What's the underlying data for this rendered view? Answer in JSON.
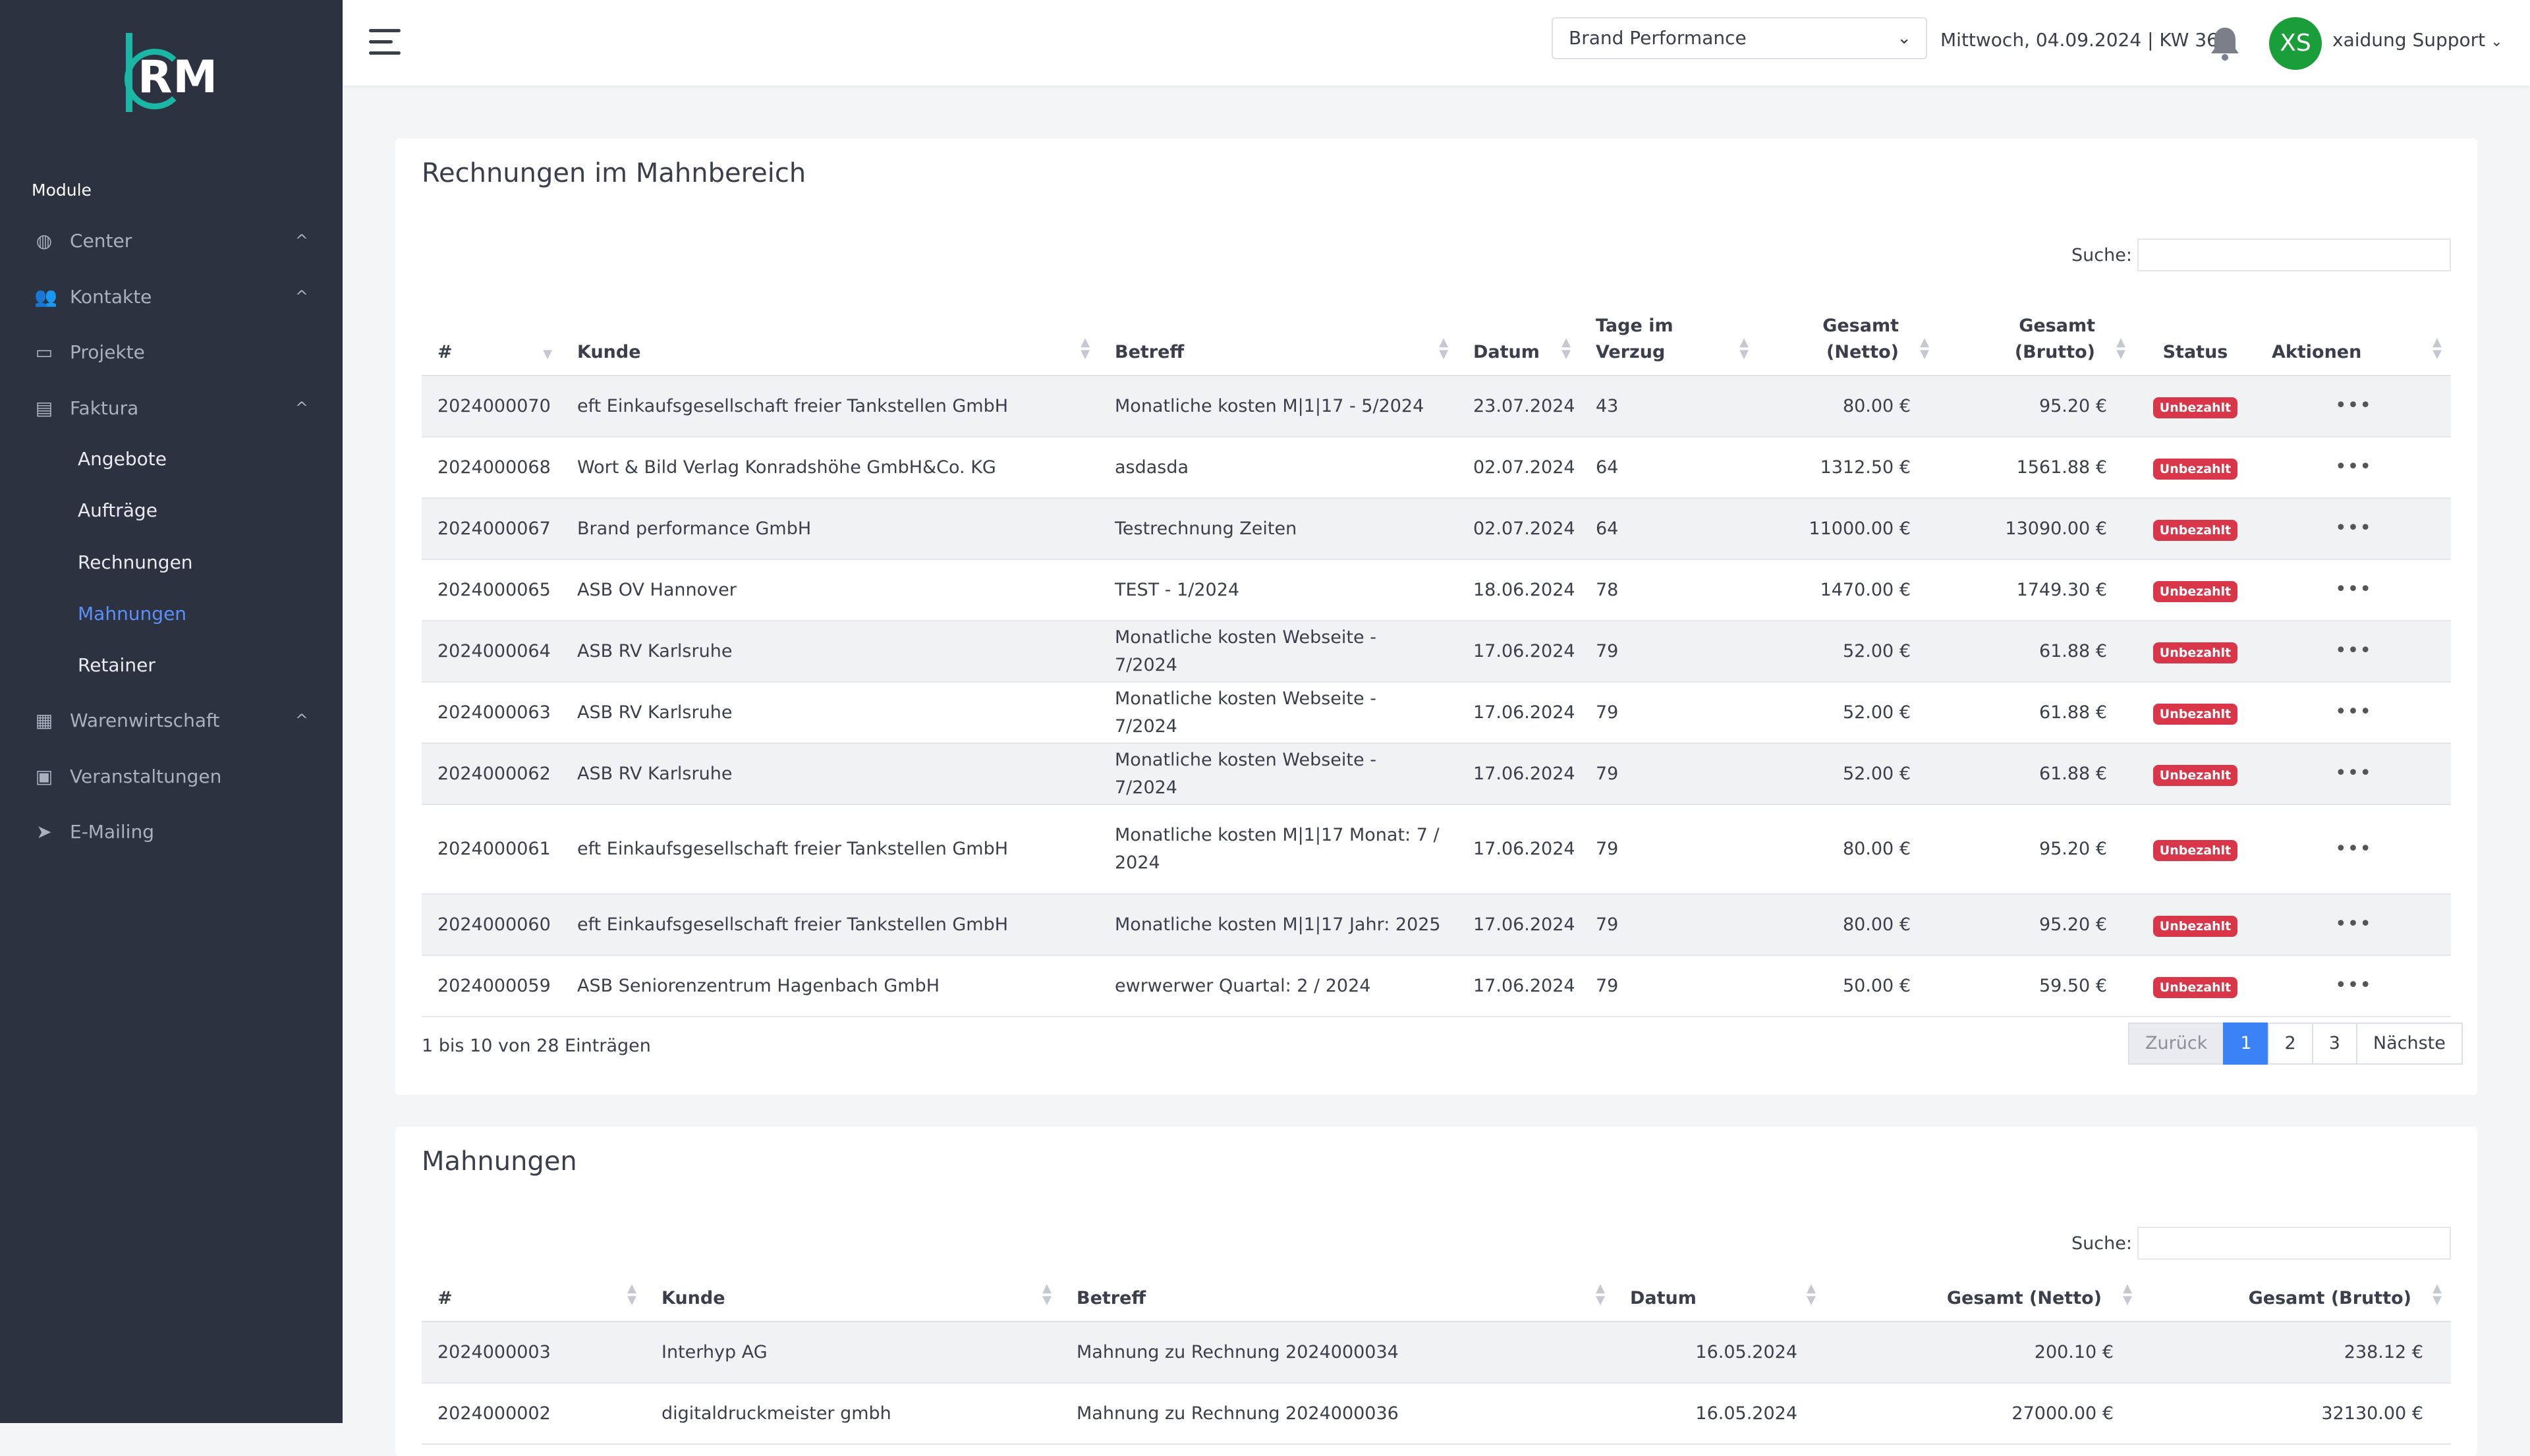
{
  "logo": "RM",
  "sidebar": {
    "module_label": "Module",
    "items": [
      {
        "label": "Center",
        "icon": "globe-icon",
        "glyph": "◍",
        "chevron": "^"
      },
      {
        "label": "Kontakte",
        "icon": "users-icon",
        "glyph": "👥",
        "chevron": "^"
      },
      {
        "label": "Projekte",
        "icon": "monitor-icon",
        "glyph": "▭",
        "chevron": ""
      },
      {
        "label": "Faktura",
        "icon": "money-icon",
        "glyph": "▤",
        "chevron": "^"
      },
      {
        "label": "Warenwirtschaft",
        "icon": "cubes-icon",
        "glyph": "▦",
        "chevron": "^"
      },
      {
        "label": "Veranstaltungen",
        "icon": "calendar-icon",
        "glyph": "▣",
        "chevron": ""
      },
      {
        "label": "E-Mailing",
        "icon": "paper-plane-icon",
        "glyph": "➤",
        "chevron": ""
      }
    ],
    "sub_items": [
      "Angebote",
      "Aufträge",
      "Rechnungen",
      "Mahnungen",
      "Retainer"
    ],
    "active_sub": "Mahnungen"
  },
  "topbar": {
    "company_select": "Brand Performance",
    "date": "Mittwoch, 04.09.2024 | KW 36",
    "avatar_initials": "XS",
    "avatar_color": "#1a9e3a",
    "username": "xaidung Support"
  },
  "invoices": {
    "title": "Rechnungen im Mahnbereich",
    "search_label": "Suche:",
    "columns": {
      "num": "#",
      "kunde": "Kunde",
      "betreff": "Betreff",
      "datum": "Datum",
      "tage_1": "Tage im",
      "tage_2": "Verzug",
      "netto_1": "Gesamt",
      "netto_2": "(Netto)",
      "brutto_1": "Gesamt",
      "brutto_2": "(Brutto)",
      "status": "Status",
      "aktionen": "Aktionen"
    },
    "rows": [
      {
        "num": "2024000070",
        "kunde": "eft Einkaufsgesellschaft freier Tankstellen GmbH",
        "betreff": "Monatliche kosten M|1|17 - 5/2024",
        "datum": "23.07.2024",
        "tage": "43",
        "netto": "80.00 €",
        "brutto": "95.20 €",
        "status": "Unbezahlt"
      },
      {
        "num": "2024000068",
        "kunde": "Wort & Bild Verlag Konradshöhe GmbH&Co. KG",
        "betreff": "asdasda",
        "datum": "02.07.2024",
        "tage": "64",
        "netto": "1312.50 €",
        "brutto": "1561.88 €",
        "status": "Unbezahlt"
      },
      {
        "num": "2024000067",
        "kunde": "Brand performance GmbH",
        "betreff": "Testrechnung Zeiten",
        "datum": "02.07.2024",
        "tage": "64",
        "netto": "11000.00 €",
        "brutto": "13090.00 €",
        "status": "Unbezahlt"
      },
      {
        "num": "2024000065",
        "kunde": "ASB OV Hannover",
        "betreff": "TEST - 1/2024",
        "datum": "18.06.2024",
        "tage": "78",
        "netto": "1470.00 €",
        "brutto": "1749.30 €",
        "status": "Unbezahlt"
      },
      {
        "num": "2024000064",
        "kunde": "ASB RV Karlsruhe",
        "betreff": "Monatliche kosten Webseite - 7/2024",
        "datum": "17.06.2024",
        "tage": "79",
        "netto": "52.00 €",
        "brutto": "61.88 €",
        "status": "Unbezahlt"
      },
      {
        "num": "2024000063",
        "kunde": "ASB RV Karlsruhe",
        "betreff": "Monatliche kosten Webseite - 7/2024",
        "datum": "17.06.2024",
        "tage": "79",
        "netto": "52.00 €",
        "brutto": "61.88 €",
        "status": "Unbezahlt"
      },
      {
        "num": "2024000062",
        "kunde": "ASB RV Karlsruhe",
        "betreff": "Monatliche kosten Webseite - 7/2024",
        "datum": "17.06.2024",
        "tage": "79",
        "netto": "52.00 €",
        "brutto": "61.88 €",
        "status": "Unbezahlt"
      },
      {
        "num": "2024000061",
        "kunde": "eft Einkaufsgesellschaft freier Tankstellen GmbH",
        "betreff": "Monatliche kosten M|1|17 Monat: 7 / 2024",
        "datum": "17.06.2024",
        "tage": "79",
        "netto": "80.00 €",
        "brutto": "95.20 €",
        "status": "Unbezahlt"
      },
      {
        "num": "2024000060",
        "kunde": "eft Einkaufsgesellschaft freier Tankstellen GmbH",
        "betreff": "Monatliche kosten M|1|17 Jahr: 2025",
        "datum": "17.06.2024",
        "tage": "79",
        "netto": "80.00 €",
        "brutto": "95.20 €",
        "status": "Unbezahlt"
      },
      {
        "num": "2024000059",
        "kunde": "ASB Seniorenzentrum Hagenbach GmbH",
        "betreff": "ewrwerwer Quartal: 2 / 2024",
        "datum": "17.06.2024",
        "tage": "79",
        "netto": "50.00 €",
        "brutto": "59.50 €",
        "status": "Unbezahlt"
      }
    ],
    "info": "1 bis 10 von 28 Einträgen",
    "pager": {
      "prev": "Zurück",
      "pages": [
        "1",
        "2",
        "3"
      ],
      "active": "1",
      "next": "Nächste"
    }
  },
  "dunning": {
    "title": "Mahnungen",
    "search_label": "Suche:",
    "columns": {
      "num": "#",
      "kunde": "Kunde",
      "betreff": "Betreff",
      "datum": "Datum",
      "netto": "Gesamt (Netto)",
      "brutto": "Gesamt (Brutto)"
    },
    "rows": [
      {
        "num": "2024000003",
        "kunde": "Interhyp AG",
        "betreff": "Mahnung zu Rechnung 2024000034",
        "datum": "16.05.2024",
        "netto": "200.10 €",
        "brutto": "238.12 €"
      },
      {
        "num": "2024000002",
        "kunde": "digitaldruckmeister gmbh",
        "betreff": "Mahnung zu Rechnung 2024000036",
        "datum": "16.05.2024",
        "netto": "27000.00 €",
        "brutto": "32130.00 €"
      }
    ]
  },
  "colors": {
    "sidebar_bg": "#2d3240",
    "accent": "#3b82f6",
    "active_nav": "#5b8ff9",
    "badge_red": "#d9364a",
    "logo_teal": "#1ab7a6"
  }
}
